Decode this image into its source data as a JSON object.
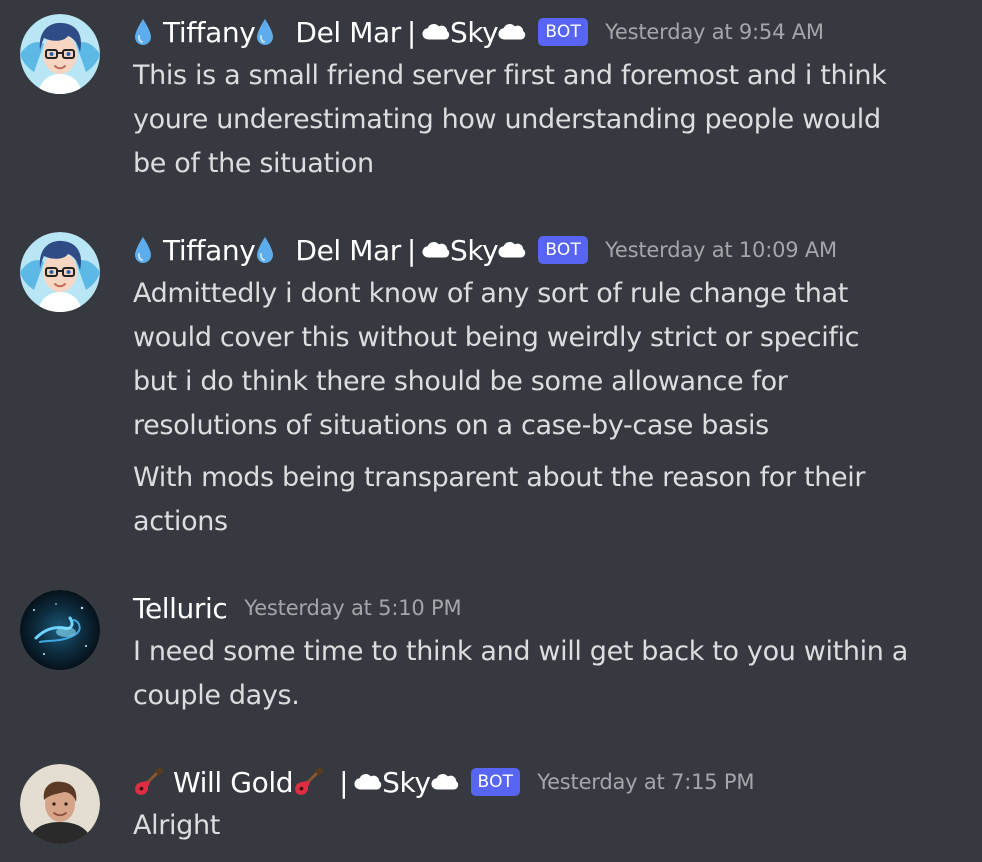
{
  "messages": [
    {
      "username": "Tiffany",
      "username_suffix": "Del Mar",
      "divider": "|",
      "server": "Sky",
      "bot_label": "BOT",
      "timestamp": "Yesterday at 9:54 AM",
      "avatar_icon": "anime-boy-with-glasses",
      "lines": [
        "This is a small friend server first and foremost and i think",
        "youre underestimating how understanding people would",
        "be of the situation"
      ]
    },
    {
      "username": "Tiffany",
      "username_suffix": "Del Mar",
      "divider": "|",
      "server": "Sky",
      "bot_label": "BOT",
      "timestamp": "Yesterday at 10:09 AM",
      "avatar_icon": "anime-boy-with-glasses",
      "lines": [
        "Admittedly i dont know of any sort of rule change that",
        "would cover this without being weirdly strict or specific",
        "but i do think there should be some allowance for",
        "resolutions of situations on a case-by-case basis"
      ],
      "lines2": [
        "With mods being transparent about the reason for their",
        "actions"
      ]
    },
    {
      "username": "Telluric",
      "timestamp": "Yesterday at 5:10 PM",
      "avatar_icon": "galaxy",
      "lines": [
        "I need some time to think and will get back to you within a",
        "couple days."
      ]
    },
    {
      "username": "Will Gold",
      "divider": "|",
      "server": "Sky",
      "bot_label": "BOT",
      "timestamp": "Yesterday at 7:15 PM",
      "avatar_icon": "person-photo",
      "lines": [
        "Alright"
      ]
    }
  ],
  "colors": {
    "background": "#36393f",
    "username": "#ffffff",
    "message_text": "#dcddde",
    "timestamp": "#a3a6aa",
    "bot_tag": "#5865f2"
  },
  "emoji": {
    "droplet": "droplet-emoji",
    "cloud": "cloud-emoji",
    "guitar": "guitar-emoji"
  }
}
